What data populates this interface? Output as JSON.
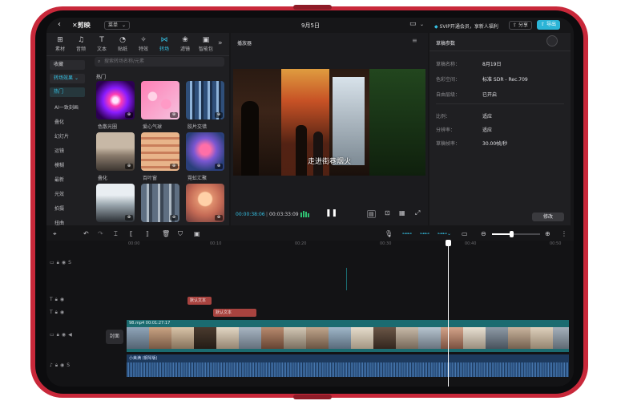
{
  "topbar": {
    "back_icon": "chevron-left-icon",
    "logo_text": "剪映",
    "menu_label": "菜单",
    "date_title": "9月5日",
    "svip_text": "SVIP开通会员，享新人福利",
    "share_label": "分享",
    "export_label": "导出"
  },
  "tools": [
    {
      "label": "素材",
      "icon": "media-icon"
    },
    {
      "label": "音频",
      "icon": "audio-icon"
    },
    {
      "label": "文本",
      "icon": "text-icon"
    },
    {
      "label": "贴纸",
      "icon": "sticker-icon"
    },
    {
      "label": "特效",
      "icon": "effects-icon"
    },
    {
      "label": "转场",
      "icon": "transition-icon"
    },
    {
      "label": "滤镜",
      "icon": "filter-icon"
    },
    {
      "label": "智能包",
      "icon": "smart-icon"
    }
  ],
  "left_categories": {
    "favorites": "收藏",
    "transition_effects": "转场效果",
    "hot": "热门",
    "items": [
      "AI一致刻画",
      "叠化",
      "幻灯片",
      "运镜",
      "模糊",
      "最新",
      "光效",
      "拍摄",
      "扭曲"
    ]
  },
  "search_placeholder": "搜索转场名称/元素",
  "section_title": "热门",
  "thumbnails": [
    {
      "label": "色散光圈"
    },
    {
      "label": "爱心气球"
    },
    {
      "label": "胶片交错"
    },
    {
      "label": "叠化"
    },
    {
      "label": "百叶窗"
    },
    {
      "label": "霓虹汇聚"
    },
    {
      "label": ""
    },
    {
      "label": ""
    },
    {
      "label": ""
    }
  ],
  "player": {
    "title": "播放器",
    "subtitle": "走进街巷烟火",
    "current_time": "00:00:38:06",
    "total_time": "00:03:33:09"
  },
  "params": {
    "title": "草稿参数",
    "rows": [
      {
        "key": "草稿名称：",
        "value": "8月19日"
      },
      {
        "key": "色彩空间：",
        "value": "标准 SDR - Rec.709"
      },
      {
        "key": "自由层级：",
        "value": "已开启"
      },
      {
        "key": "比例：",
        "value": "适应"
      },
      {
        "key": "分辨率：",
        "value": "适应"
      },
      {
        "key": "草稿帧率：",
        "value": "30.00帧/秒"
      }
    ],
    "modify_label": "修改"
  },
  "timeline": {
    "ruler": [
      "00:00",
      "00:10",
      "00:20",
      "00:30",
      "00:40",
      "00:50"
    ],
    "text_clip_1": "默认文本",
    "text_clip_2": "默认文本",
    "video_clip": "98.mp4  00:01:27:17",
    "cover_label": "封面",
    "audio_clip": "小美满 (钢琴版)"
  },
  "colors": {
    "accent": "#35c0e3",
    "device": "#c8283a",
    "text_clip": "#a8433f",
    "video_track": "#1b6b70",
    "audio_track": "#1d3a5e"
  }
}
